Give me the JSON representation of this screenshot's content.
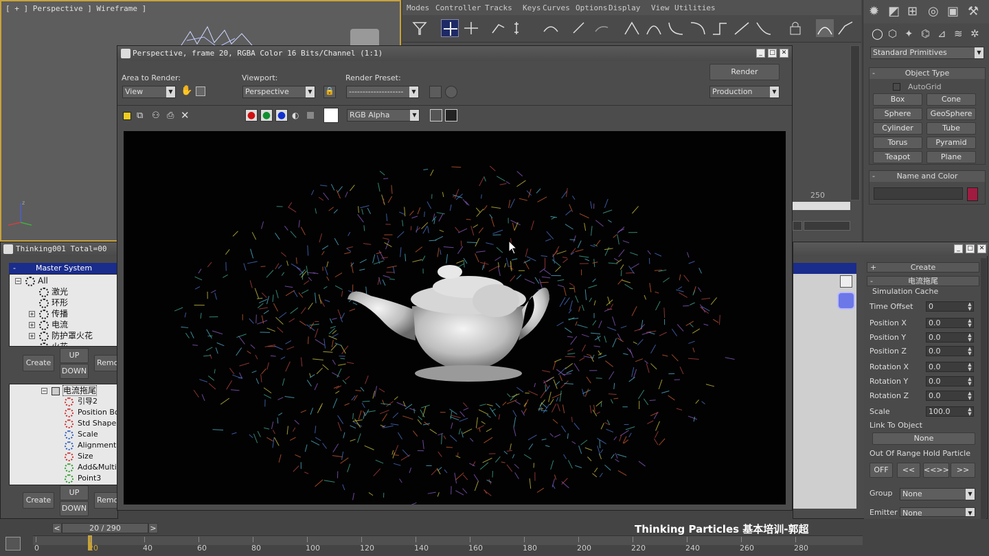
{
  "viewport": {
    "label": "[ + ] Perspective ] Wireframe ]"
  },
  "trackview": {
    "menu": [
      "Modes",
      "Controller",
      "Tracks",
      "Keys",
      "Curves",
      "Options",
      "Display",
      "View",
      "Utilities"
    ],
    "ruler_value": "250"
  },
  "render_window": {
    "title": "Perspective, frame 20, RGBA Color 16 Bits/Channel (1:1)",
    "area_label": "Area to Render:",
    "area_value": "View",
    "viewport_label": "Viewport:",
    "viewport_value": "Perspective",
    "preset_label": "Render Preset:",
    "preset_value": "--------------------",
    "render_button": "Render",
    "production_value": "Production",
    "channel_value": "RGB Alpha"
  },
  "thinking": {
    "title": "Thinking001   Total=00",
    "master_header": "Master System",
    "tree": [
      "All",
      "激光",
      "环形",
      "传播",
      "电流",
      "防护罩火花",
      "火花"
    ],
    "create": "Create",
    "up": "UP",
    "down": "DOWN",
    "remove": "Remo",
    "ops_header": "电流拖尾",
    "ops": [
      "引导2",
      "Position Bor",
      "Std Shape",
      "Scale",
      "Alignment",
      "Size",
      "Add&Multip",
      "Point3"
    ],
    "create2": "Create",
    "up2": "UP",
    "down2": "DOWN",
    "remove2": "Remo"
  },
  "right_panel": {
    "dropdown": "Standard Primitives",
    "object_type": "Object Type",
    "autogrid": "AutoGrid",
    "primitives": [
      "Box",
      "Cone",
      "Sphere",
      "GeoSphere",
      "Cylinder",
      "Tube",
      "Torus",
      "Pyramid",
      "Teapot",
      "Plane"
    ],
    "name_color": "Name and Color",
    "name_value": ""
  },
  "tp_panel": {
    "create": "Create",
    "header": "电流拖尾",
    "section": "Simulation Cache",
    "fields": [
      {
        "label": "Time Offset",
        "value": "0"
      },
      {
        "label": "Position X",
        "value": "0.0"
      },
      {
        "label": "Position Y",
        "value": "0.0"
      },
      {
        "label": "Position Z",
        "value": "0.0"
      },
      {
        "label": "Rotation X",
        "value": "0.0"
      },
      {
        "label": "Rotation Y",
        "value": "0.0"
      },
      {
        "label": "Rotation Z",
        "value": "0.0"
      },
      {
        "label": "Scale",
        "value": "100.0"
      }
    ],
    "link_label": "Link To Object",
    "link_value": "None",
    "range_label": "Out Of Range Hold Particle",
    "off": "OFF",
    "prev": "<<",
    "both": "<<>>",
    "next": ">>",
    "group_label": "Group",
    "group_value": "None",
    "emitter_label": "Emitter",
    "emitter_value": "None"
  },
  "timeline": {
    "frame": "20 / 290",
    "prev": "<",
    "next": ">",
    "watermark": "Thinking Particles 基本培训-郭超",
    "ticks": [
      "0",
      "20",
      "40",
      "60",
      "80",
      "100",
      "120",
      "140",
      "160",
      "180",
      "200",
      "220",
      "240",
      "260",
      "280"
    ]
  },
  "colors": {
    "accent": "#1a2c8c",
    "swatch": "#a01c40"
  }
}
